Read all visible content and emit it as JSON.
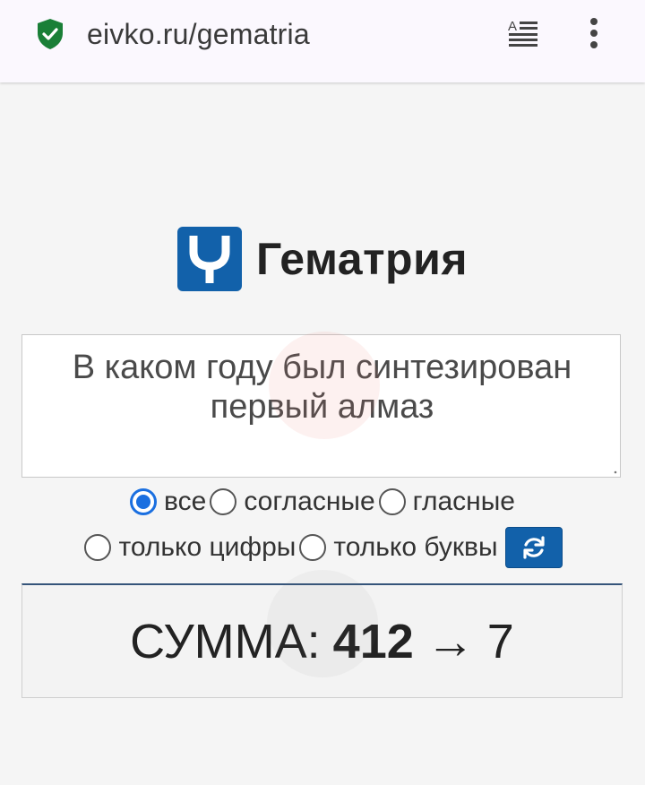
{
  "browser": {
    "url": "eivko.ru/gematria",
    "secure_icon": "shield-check-icon",
    "reader_icon": "reader-mode-icon",
    "menu_icon": "more-vertical-icon",
    "accent_color": "#1a7f37"
  },
  "header": {
    "logo_icon": "fork-y-icon",
    "title": "Гематрия",
    "brand_color": "#1261aa"
  },
  "input": {
    "value": "В каком году был синтезирован первый алмаз"
  },
  "filters": {
    "options": [
      {
        "label": "все",
        "checked": true
      },
      {
        "label": "согласные",
        "checked": false
      },
      {
        "label": "гласные",
        "checked": false
      },
      {
        "label": "только цифры",
        "checked": false
      },
      {
        "label": "только буквы",
        "checked": false
      }
    ],
    "refresh_icon": "refresh-icon"
  },
  "result": {
    "label": "СУММА:",
    "sum": "412",
    "arrow": "→",
    "reduced": "7"
  }
}
